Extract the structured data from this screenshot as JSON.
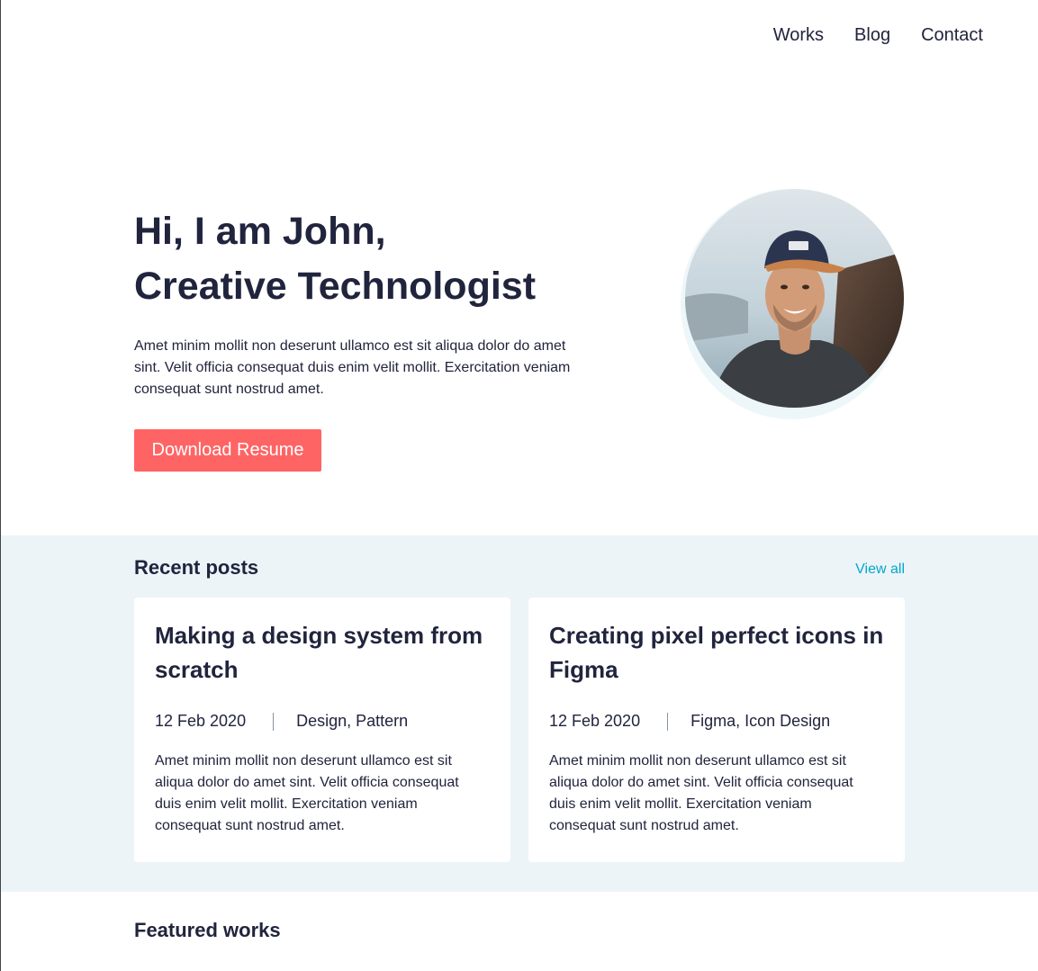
{
  "nav": {
    "items": [
      {
        "label": "Works"
      },
      {
        "label": "Blog"
      },
      {
        "label": "Contact"
      }
    ]
  },
  "hero": {
    "title_line1": "Hi, I am John,",
    "title_line2": "Creative Technologist",
    "description": "Amet minim mollit non deserunt ullamco est sit aliqua dolor do amet sint. Velit officia consequat duis enim velit mollit. Exercitation veniam consequat sunt nostrud amet.",
    "button_label": "Download Resume",
    "avatar_alt": "profile-photo"
  },
  "recent_posts": {
    "heading": "Recent posts",
    "view_all": "View all",
    "posts": [
      {
        "title": "Making a design system from scratch",
        "date": "12 Feb 2020",
        "tags": "Design, Pattern",
        "excerpt": "Amet minim mollit non deserunt ullamco est sit aliqua dolor do amet sint. Velit officia consequat duis enim velit mollit. Exercitation veniam consequat sunt nostrud amet."
      },
      {
        "title": "Creating pixel perfect icons in Figma",
        "date": "12 Feb 2020",
        "tags": "Figma, Icon Design",
        "excerpt": "Amet minim mollit non deserunt ullamco est sit aliqua dolor do amet sint. Velit officia consequat duis enim velit mollit. Exercitation veniam consequat sunt nostrud amet."
      }
    ]
  },
  "featured": {
    "heading": "Featured works"
  },
  "colors": {
    "text": "#21243D",
    "accent": "#FF6464",
    "link": "#00A8CC",
    "section_bg": "#EDF4F8"
  }
}
